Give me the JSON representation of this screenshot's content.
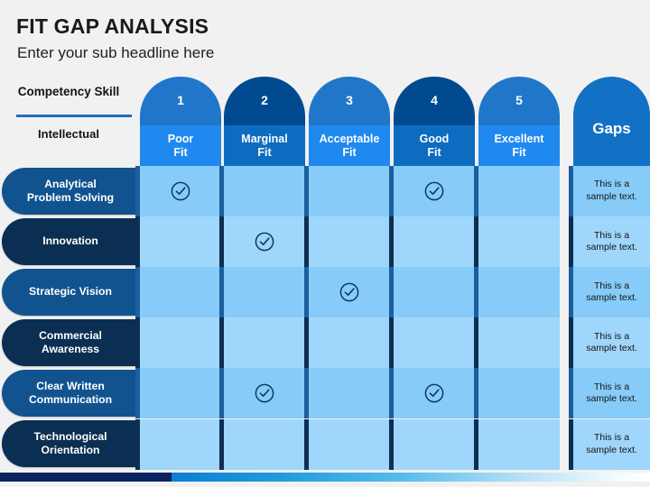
{
  "slide": {
    "title": "FIT GAP ANALYSIS",
    "subtitle": "Enter your sub headline here",
    "background": "#f1f1f1"
  },
  "corner": {
    "title": "Competency Skill",
    "sub": "Intellectual",
    "rule_color": "#1f6fc0"
  },
  "columns": [
    {
      "num": "1",
      "label": "Poor\nFit",
      "arch_color": "#2077c9",
      "body_color": "#2089f0",
      "cell_color_odd": "#87ccf8",
      "cell_color_even": "#9fd6fb",
      "divider_odd": "#1c5f9e",
      "divider_even": "#0d2f52"
    },
    {
      "num": "2",
      "label": "Marginal\nFit",
      "arch_color": "#024a8f",
      "body_color": "#0d6cc0",
      "cell_color_odd": "#87ccf8",
      "cell_color_even": "#9fd6fb",
      "divider_odd": "#1c5f9e",
      "divider_even": "#0d2f52"
    },
    {
      "num": "3",
      "label": "Acceptable\nFit",
      "arch_color": "#2077c9",
      "body_color": "#2089f0",
      "cell_color_odd": "#87ccf8",
      "cell_color_even": "#9fd6fb",
      "divider_odd": "#1c5f9e",
      "divider_even": "#0d2f52"
    },
    {
      "num": "4",
      "label": "Good\nFit",
      "arch_color": "#024a8f",
      "body_color": "#0d6cc0",
      "cell_color_odd": "#87ccf8",
      "cell_color_even": "#9fd6fb",
      "divider_odd": "#1c5f9e",
      "divider_even": "#0d2f52"
    },
    {
      "num": "5",
      "label": "Excellent\nFit",
      "arch_color": "#2077c9",
      "body_color": "#2089f0",
      "cell_color_odd": "#87ccf8",
      "cell_color_even": "#9fd6fb",
      "divider_odd": "#1c5f9e",
      "divider_even": "#0d2f52"
    }
  ],
  "gaps_column": {
    "label": "Gaps",
    "header_color": "#1271c4",
    "cell_color_odd": "#87ccf8",
    "cell_color_even": "#9fd6fb"
  },
  "rows": [
    {
      "label": "Analytical\nProblem Solving",
      "label_color": "#11538f",
      "checks": [
        true,
        false,
        false,
        true,
        false
      ],
      "gap_text": "This is a\nsample text."
    },
    {
      "label": "Innovation",
      "label_color": "#0b2f52",
      "checks": [
        false,
        true,
        false,
        false,
        false
      ],
      "gap_text": "This is a\nsample text."
    },
    {
      "label": "Strategic Vision",
      "label_color": "#11538f",
      "checks": [
        false,
        false,
        true,
        false,
        false
      ],
      "gap_text": "This is a\nsample text."
    },
    {
      "label": "Commercial\nAwareness",
      "label_color": "#0b2f52",
      "checks": [
        false,
        false,
        false,
        false,
        false
      ],
      "gap_text": "This is a\nsample text."
    },
    {
      "label": "Clear Written\nCommunication",
      "label_color": "#11538f",
      "checks": [
        false,
        true,
        false,
        true,
        false
      ],
      "gap_text": "This is a\nsample text."
    },
    {
      "label": "Technological\nOrientation",
      "label_color": "#0b2f52",
      "checks": [
        false,
        false,
        false,
        false,
        false
      ],
      "gap_text": "This is a\nsample text."
    }
  ],
  "check_icon": {
    "name": "check-circle-icon",
    "color": "#0c3a63"
  },
  "bottom_bar": {
    "solid_color": "#0c2461",
    "gradient_start": "#0b7fd4",
    "gradient_end": "#ffffff"
  }
}
